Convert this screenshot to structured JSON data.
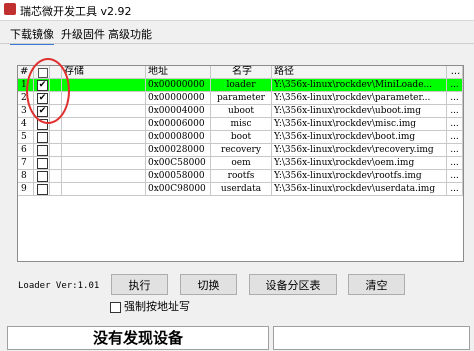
{
  "window": {
    "title": "瑞芯微开发工具 v2.92"
  },
  "tabs": [
    {
      "label": "下载镜像"
    },
    {
      "label": "升级固件"
    },
    {
      "label": "高级功能"
    }
  ],
  "table": {
    "headers": {
      "num": "#",
      "store": "存储",
      "addr": "地址",
      "name": "名字",
      "path": "路径",
      "more": "..."
    },
    "rows": [
      {
        "num": "1",
        "checked": true,
        "addr": "0x00000000",
        "name": "loader",
        "path": "Y:\\356x-linux\\rockdev\\MiniLoade...",
        "more": "...",
        "selected": true
      },
      {
        "num": "2",
        "checked": true,
        "addr": "0x00000000",
        "name": "parameter",
        "path": "Y:\\356x-linux\\rockdev\\parameter...",
        "more": "..."
      },
      {
        "num": "3",
        "checked": true,
        "addr": "0x00004000",
        "name": "uboot",
        "path": "Y:\\356x-linux\\rockdev\\uboot.img",
        "more": "..."
      },
      {
        "num": "4",
        "checked": false,
        "addr": "0x00006000",
        "name": "misc",
        "path": "Y:\\356x-linux\\rockdev\\misc.img",
        "more": "..."
      },
      {
        "num": "5",
        "checked": false,
        "addr": "0x00008000",
        "name": "boot",
        "path": "Y:\\356x-linux\\rockdev\\boot.img",
        "more": "..."
      },
      {
        "num": "6",
        "checked": false,
        "addr": "0x00028000",
        "name": "recovery",
        "path": "Y:\\356x-linux\\rockdev\\recovery.img",
        "more": "..."
      },
      {
        "num": "7",
        "checked": false,
        "addr": "0x00C58000",
        "name": "oem",
        "path": "Y:\\356x-linux\\rockdev\\oem.img",
        "more": "..."
      },
      {
        "num": "8",
        "checked": false,
        "addr": "0x00058000",
        "name": "rootfs",
        "path": "Y:\\356x-linux\\rockdev\\rootfs.img",
        "more": "..."
      },
      {
        "num": "9",
        "checked": false,
        "addr": "0x00C98000",
        "name": "userdata",
        "path": "Y:\\356x-linux\\rockdev\\userdata.img",
        "more": "..."
      }
    ]
  },
  "loader_version": "Loader Ver:1.01",
  "buttons": {
    "execute": "执行",
    "switch": "切换",
    "partition": "设备分区表",
    "clear": "清空"
  },
  "force_write": {
    "label": "强制按地址写",
    "checked": false
  },
  "status": {
    "text": "没有发现设备"
  },
  "colors": {
    "selected_row": "#00ff00",
    "annotation_circle": "#e03030"
  }
}
